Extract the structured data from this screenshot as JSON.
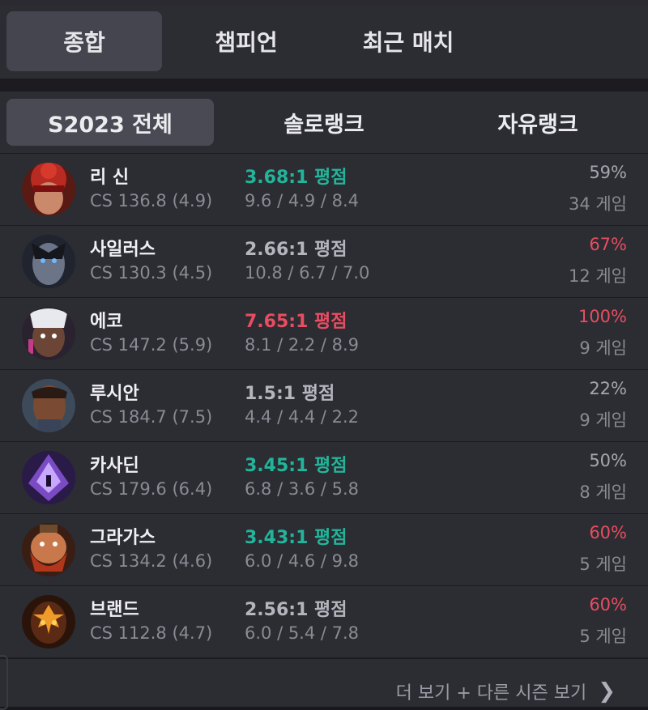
{
  "tabs": [
    {
      "label": "종합",
      "active": true
    },
    {
      "label": "챔피언",
      "active": false
    },
    {
      "label": "최근 매치",
      "active": false
    }
  ],
  "season_tabs": [
    {
      "label": "S2023 전체",
      "active": true
    },
    {
      "label": "솔로랭크",
      "active": false
    },
    {
      "label": "자유랭크",
      "active": false
    }
  ],
  "champions": [
    {
      "name": "리 신",
      "cs": "CS 136.8 (4.9)",
      "kda_ratio": "3.68:1 평점",
      "kda_color": "green",
      "kda": "9.6 / 4.9 / 8.4",
      "winrate": "59%",
      "winrate_color": "normal",
      "games": "34 게임",
      "icon": "lee-sin-portrait"
    },
    {
      "name": "사일러스",
      "cs": "CS 130.3 (4.5)",
      "kda_ratio": "2.66:1 평점",
      "kda_color": "normal",
      "kda": "10.8 / 6.7 / 7.0",
      "winrate": "67%",
      "winrate_color": "red",
      "games": "12 게임",
      "icon": "sylas-portrait"
    },
    {
      "name": "에코",
      "cs": "CS 147.2 (5.9)",
      "kda_ratio": "7.65:1 평점",
      "kda_color": "red",
      "kda": "8.1 / 2.2 / 8.9",
      "winrate": "100%",
      "winrate_color": "red",
      "games": "9 게임",
      "icon": "ekko-portrait"
    },
    {
      "name": "루시안",
      "cs": "CS 184.7 (7.5)",
      "kda_ratio": "1.5:1 평점",
      "kda_color": "normal",
      "kda": "4.4 / 4.4 / 2.2",
      "winrate": "22%",
      "winrate_color": "normal",
      "games": "9 게임",
      "icon": "lucian-portrait"
    },
    {
      "name": "카사딘",
      "cs": "CS 179.6 (6.4)",
      "kda_ratio": "3.45:1 평점",
      "kda_color": "green",
      "kda": "6.8 / 3.6 / 5.8",
      "winrate": "50%",
      "winrate_color": "normal",
      "games": "8 게임",
      "icon": "kassadin-portrait"
    },
    {
      "name": "그라가스",
      "cs": "CS 134.2 (4.6)",
      "kda_ratio": "3.43:1 평점",
      "kda_color": "green",
      "kda": "6.0 / 4.6 / 9.8",
      "winrate": "60%",
      "winrate_color": "red",
      "games": "5 게임",
      "icon": "gragas-portrait"
    },
    {
      "name": "브랜드",
      "cs": "CS 112.8 (4.7)",
      "kda_ratio": "2.56:1 평점",
      "kda_color": "normal",
      "kda": "6.0 / 5.4 / 7.8",
      "winrate": "60%",
      "winrate_color": "red",
      "games": "5 게임",
      "icon": "brand-portrait"
    }
  ],
  "more_link": "더 보기 + 다른 시즌 보기",
  "colors": {
    "green": "#22b59a",
    "red": "#e84d61",
    "background": "#2c2c33"
  }
}
